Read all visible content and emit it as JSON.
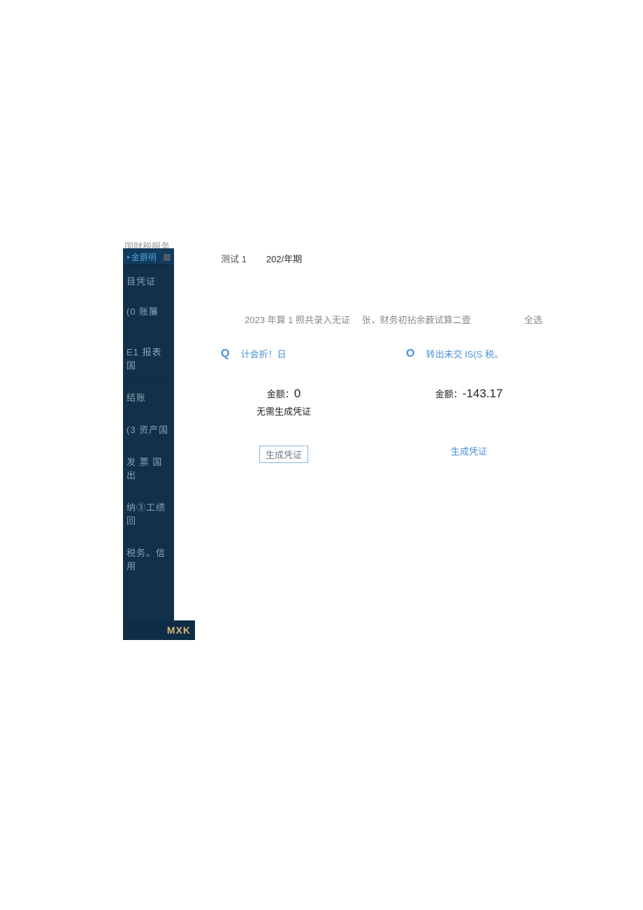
{
  "brand": "国财税服务",
  "sidebar": {
    "top": "金爵明",
    "items": [
      "目凭证",
      "(0 账簾",
      "E1 报表国",
      "结账",
      "(3 资产国",
      "发 票 国 出",
      "纳③工绩回",
      "税务。信用"
    ],
    "mxk": "MXK"
  },
  "topline": {
    "test": "测试 1",
    "period": "202/年期"
  },
  "summary": {
    "text": "2023 年算 1 照共录入无证 　张，财务初拈余薮试算二壹",
    "select_all": "全选"
  },
  "cards": [
    {
      "icon": "Q",
      "title": "计会折！日",
      "amount_label": "金额：",
      "amount_value": "0",
      "note": "无需生成凭证",
      "button": "生成凭证"
    },
    {
      "icon": "O",
      "title": "转出未交 IS(S 税。",
      "amount_label": "金额：",
      "amount_value": "-143.17",
      "note": "",
      "button": "生成凭证"
    }
  ]
}
